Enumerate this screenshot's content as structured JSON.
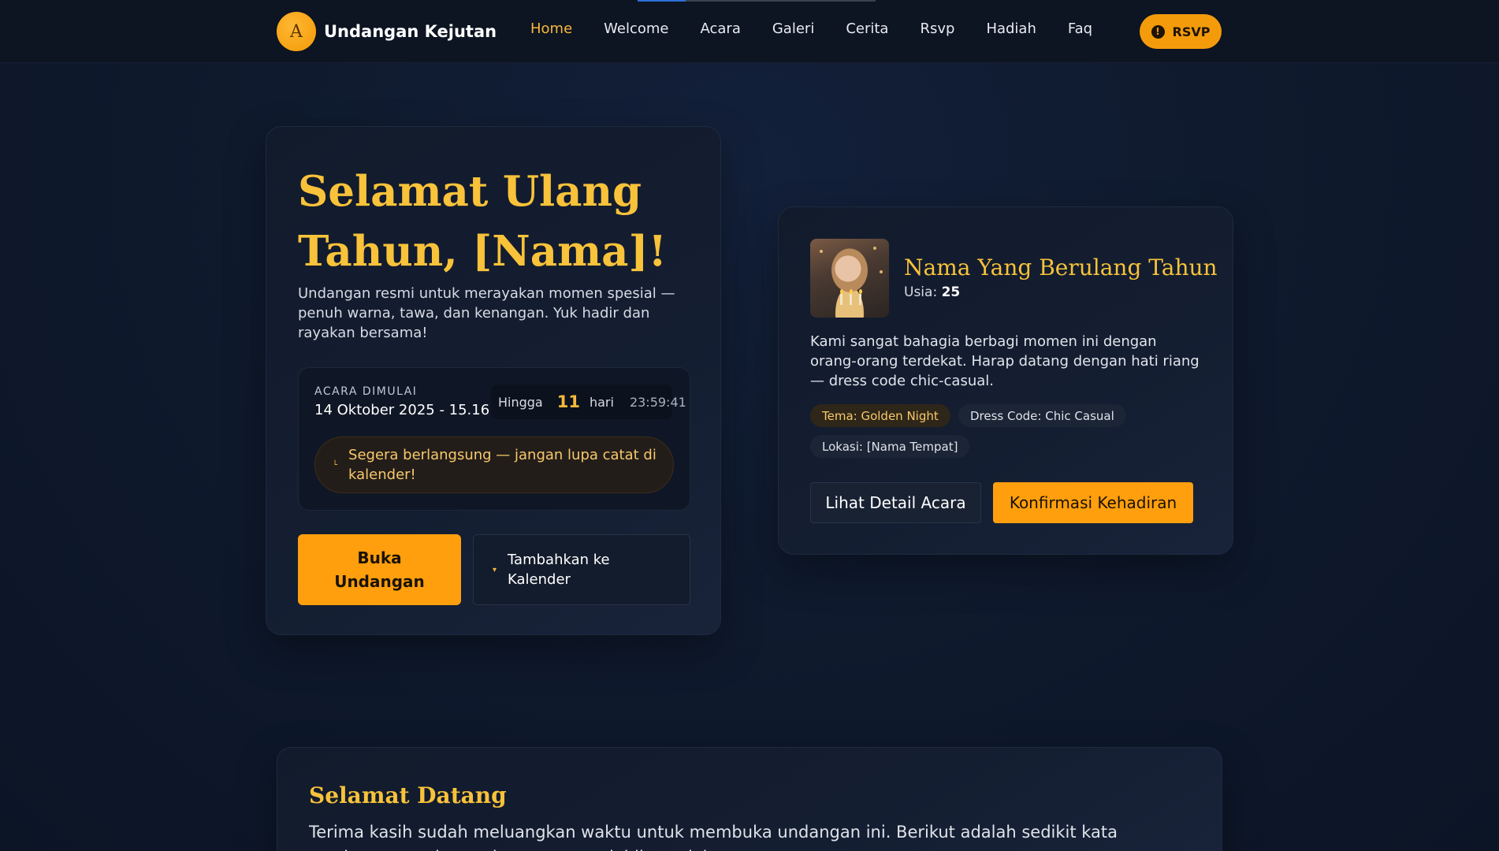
{
  "nav": {
    "brand_initial": "A",
    "brand_name": "Undangan Kejutan",
    "links": [
      "Home",
      "Welcome",
      "Acara",
      "Galeri",
      "Cerita",
      "Rsvp",
      "Hadiah",
      "Faq"
    ],
    "active": "Home",
    "rsvp_icon": "exclamation-icon",
    "rsvp_label": "RSVP"
  },
  "hero": {
    "title": "Selamat Ulang Tahun, [Nama]!",
    "subtitle": "Undangan resmi untuk merayakan momen spesial — penuh warna, tawa, dan kenangan. Yuk hadir dan rayakan bersama!",
    "event_label": "ACARA DIMULAI",
    "event_date": "14 Oktober 2025 - 15.16",
    "countdown": {
      "prefix": "Hingga",
      "days": "11",
      "unit": "hari",
      "time": "23:59:41"
    },
    "reminder_icon": "clock-icon",
    "reminder": "Segera berlangsung — jangan lupa catat di kalender!",
    "open_button": "Buka Undangan",
    "calendar_icon": "calendar-icon",
    "calendar_button": "Tambahkan ke Kalender"
  },
  "profile": {
    "name": "Nama Yang Berulang Tahun",
    "age_label": "Usia:",
    "age": "25",
    "description": "Kami sangat bahagia berbagi momen ini dengan orang-orang terdekat. Harap datang dengan hati riang — dress code chic-casual.",
    "tags": [
      "Tema: Golden Night",
      "Dress Code: Chic Casual",
      "Lokasi: [Nama Tempat]"
    ],
    "detail_button": "Lihat Detail Acara",
    "confirm_button": "Konfirmasi Kehadiran"
  },
  "welcome": {
    "title": "Selamat Datang",
    "text": "Terima kasih sudah meluangkan waktu untuk membuka undangan ini. Berikut adalah sedikit kata sambutan untuk membuat suasana lebih meriah."
  },
  "colors": {
    "accent": "#f8c23a",
    "button": "#ff9f0d",
    "background": "#0f1a2e"
  }
}
